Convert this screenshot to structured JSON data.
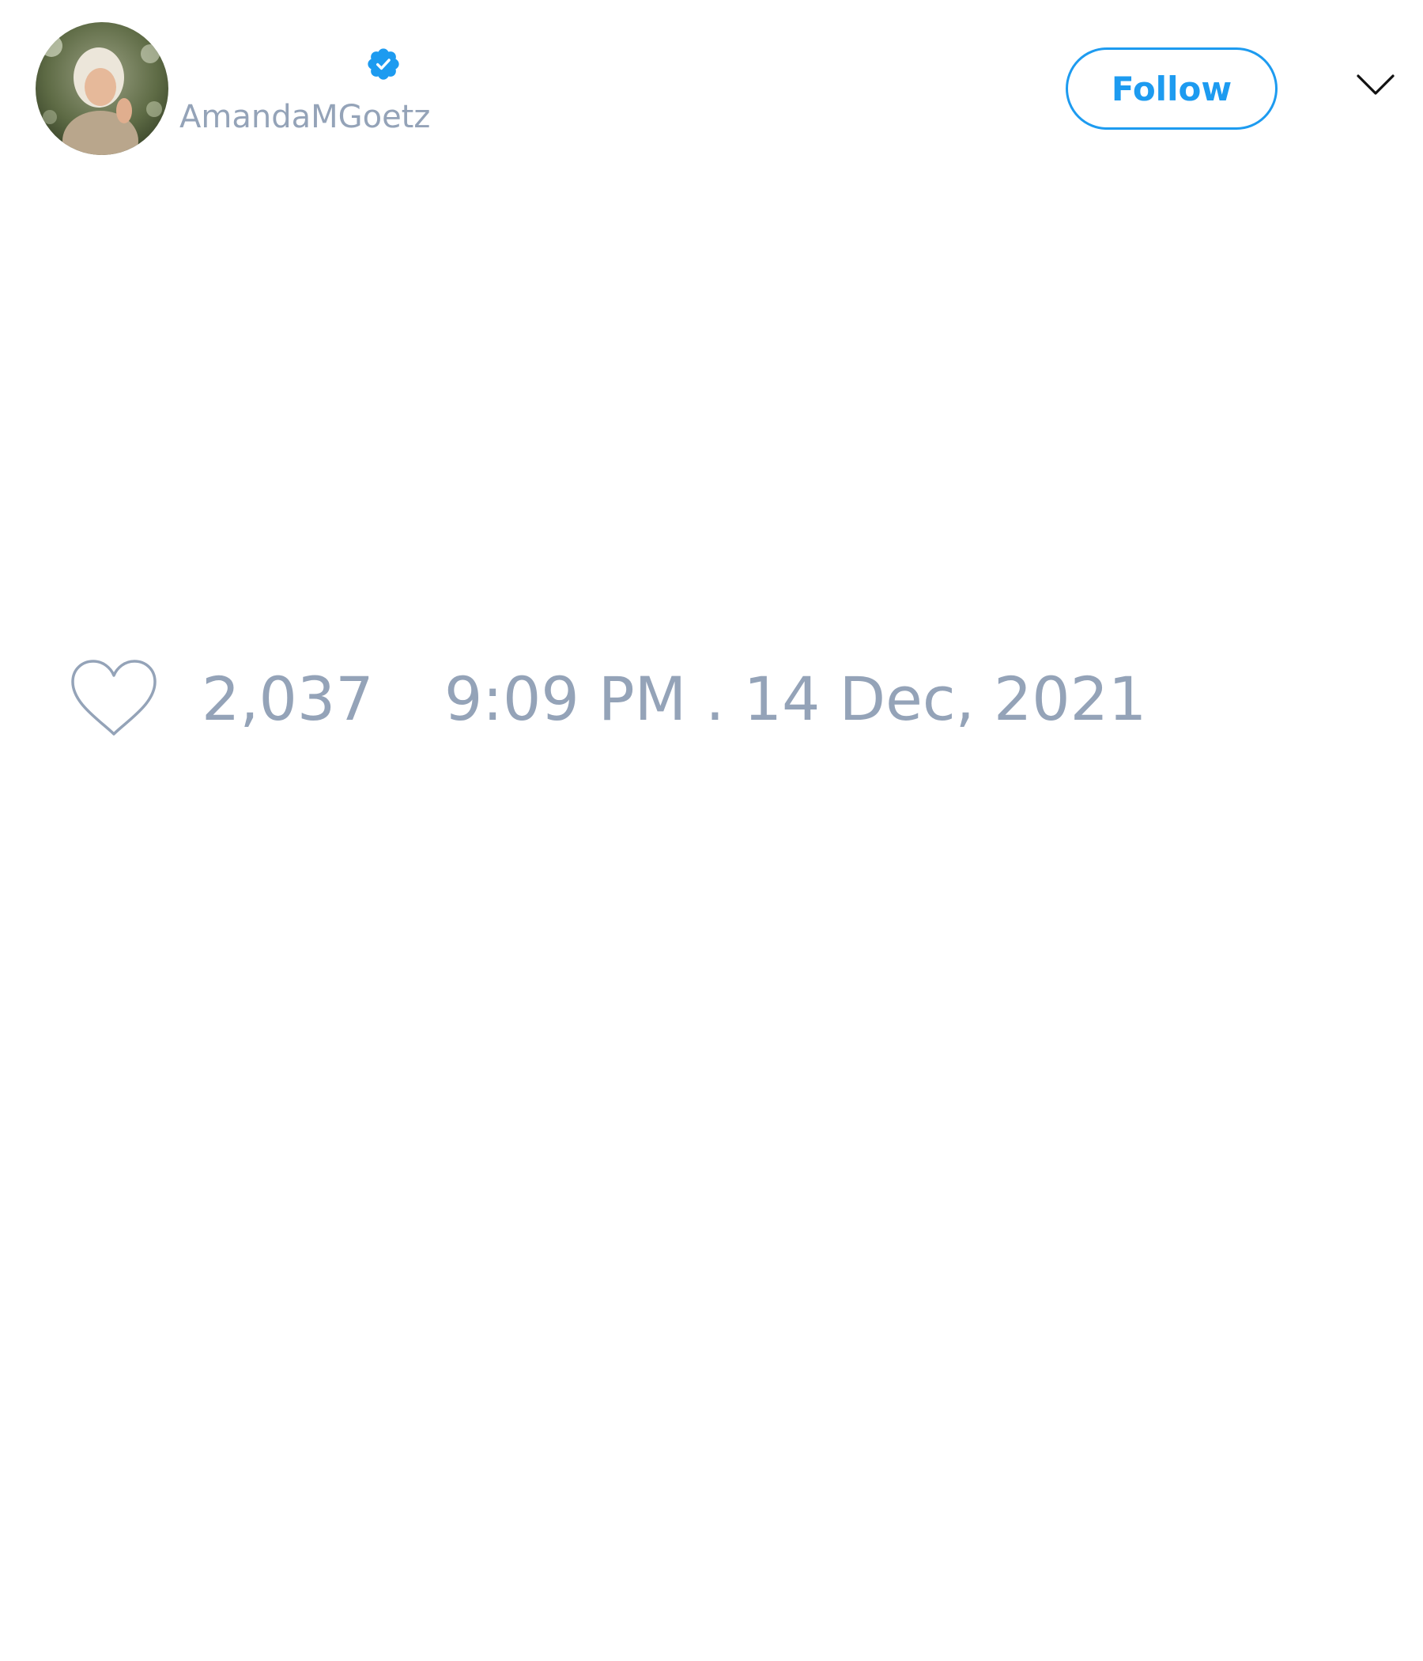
{
  "user": {
    "handle": "AmandaMGoetz",
    "avatar": "profile-photo",
    "verified_icon": "verified-badge-icon",
    "verified_color": "#1d9bf0"
  },
  "actions": {
    "follow_label": "Follow",
    "menu_icon": "chevron-down-icon"
  },
  "tweet": {
    "like_icon": "heart-icon",
    "likes": "2,037",
    "timestamp": "9:09 PM . 14 Dec, 2021"
  },
  "colors": {
    "accent": "#1d9bf0",
    "muted_text": "#94a3b8"
  }
}
